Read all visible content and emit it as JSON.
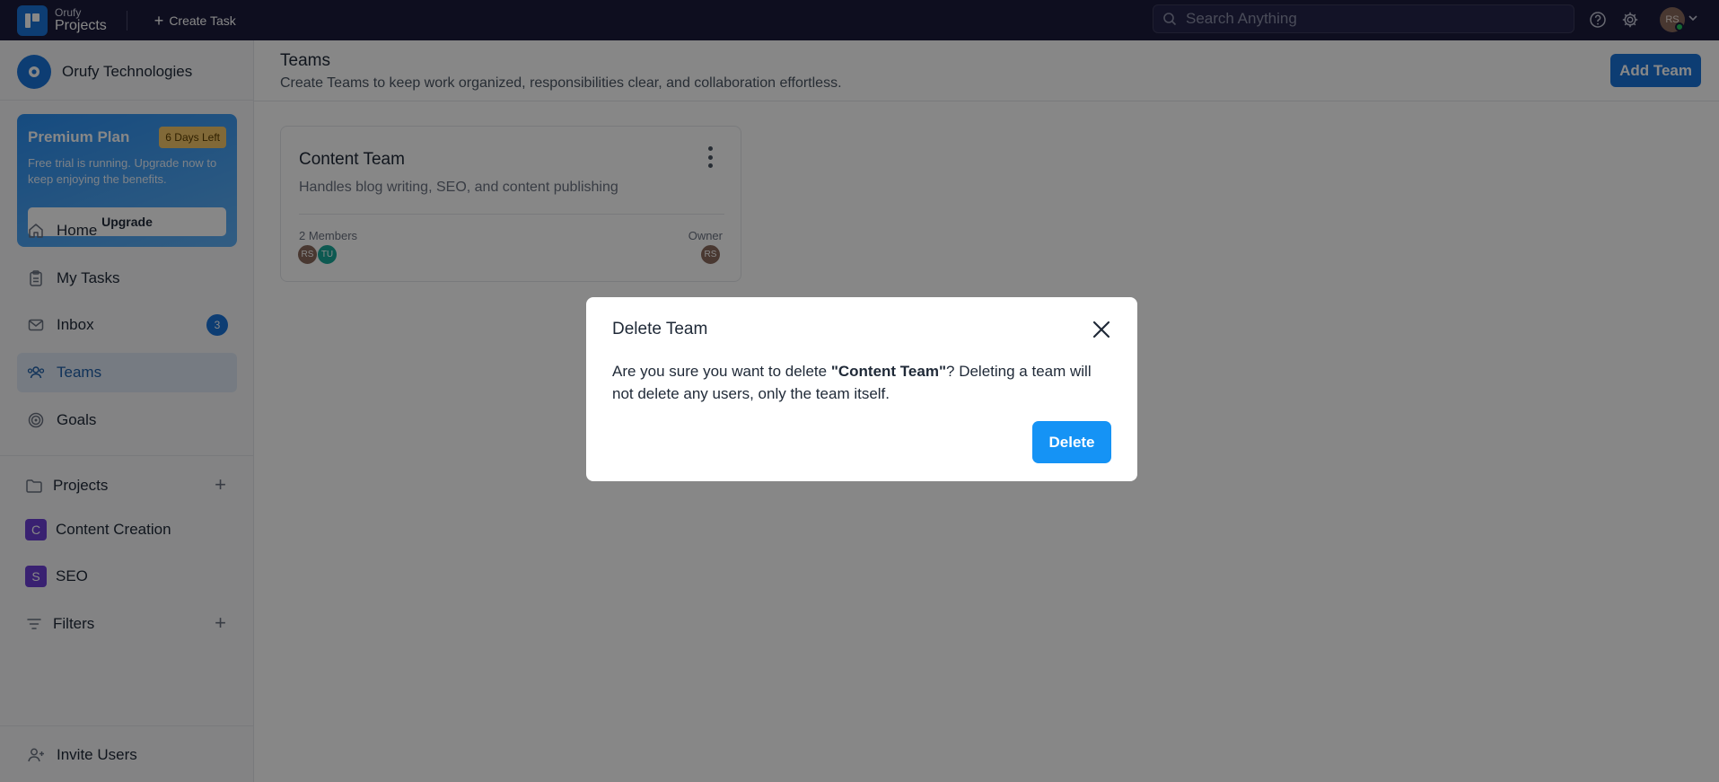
{
  "topbar": {
    "brand_small": "Orufy",
    "brand_big": "Projects",
    "create_task_label": "Create Task",
    "search_placeholder": "Search Anything",
    "avatar_initials": "RS"
  },
  "sidebar": {
    "org_name": "Orufy Technologies",
    "plan": {
      "title": "Premium Plan",
      "badge": "6 Days Left",
      "description": "Free trial is running. Upgrade now to keep enjoying the benefits.",
      "upgrade_label": "Upgrade"
    },
    "nav": [
      {
        "label": "Home",
        "icon": "home-icon"
      },
      {
        "label": "My Tasks",
        "icon": "clipboard-icon"
      },
      {
        "label": "Inbox",
        "icon": "mail-icon",
        "badge": "3"
      },
      {
        "label": "Teams",
        "icon": "users-icon",
        "active": true
      },
      {
        "label": "Goals",
        "icon": "target-icon"
      }
    ],
    "projects_label": "Projects",
    "projects": [
      {
        "letter": "C",
        "label": "Content Creation"
      },
      {
        "letter": "S",
        "label": "SEO"
      }
    ],
    "filters_label": "Filters",
    "invite_label": "Invite Users"
  },
  "main": {
    "title": "Teams",
    "subtitle": "Create Teams to keep work organized, responsibilities clear, and collaboration effortless.",
    "add_team_label": "Add Team",
    "team_card": {
      "name": "Content Team",
      "description": "Handles blog writing, SEO, and content publishing",
      "members_label": "2 Members",
      "owner_label": "Owner",
      "members": [
        {
          "initials": "RS",
          "color": "#8a6a5e"
        },
        {
          "initials": "TU",
          "color": "#1aa99a"
        }
      ],
      "owner": {
        "initials": "RS",
        "color": "#8a6a5e"
      }
    }
  },
  "modal": {
    "title": "Delete Team",
    "body_prefix": "Are you sure you want to delete ",
    "body_team": "\"Content Team\"",
    "body_suffix": "? Deleting a team will not delete any users, only the team itself.",
    "delete_label": "Delete"
  },
  "colors": {
    "topbar": "#1c1c3b",
    "accent": "#1a73d9",
    "delete_button": "#1593f5",
    "project_square": "#6d3fd6"
  }
}
